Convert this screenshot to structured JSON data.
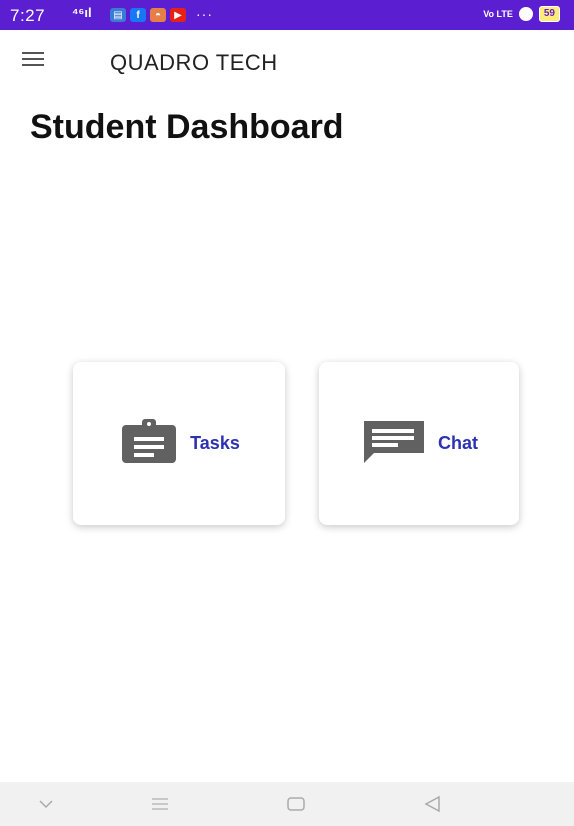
{
  "status_bar": {
    "time": "7:27",
    "signal": "⁴⁶ıl",
    "more": "···",
    "volte": "Vo LTE",
    "battery": "59",
    "app_icons": [
      {
        "name": "messages-icon",
        "color": "#3a7bd5",
        "glyph": "▤"
      },
      {
        "name": "facebook-icon",
        "color": "#1877f2",
        "glyph": "f"
      },
      {
        "name": "gallery-icon",
        "color": "#e67e4a",
        "glyph": "◓"
      },
      {
        "name": "youtube-icon",
        "color": "#e62117",
        "glyph": "▶"
      }
    ],
    "colors": {
      "background": "#5b1fd1"
    }
  },
  "app_bar": {
    "title": "QUADRO TECH"
  },
  "page": {
    "title": "Student Dashboard"
  },
  "cards": {
    "tasks": {
      "label": "Tasks",
      "icon": "clipboard-icon"
    },
    "chat": {
      "label": "Chat",
      "icon": "chat-icon"
    }
  },
  "nav_bar": {
    "buttons": [
      "down-icon",
      "recents-icon",
      "home-icon",
      "back-icon"
    ]
  },
  "colors": {
    "accent": "#2c32b0",
    "icon_gray": "#616161"
  }
}
